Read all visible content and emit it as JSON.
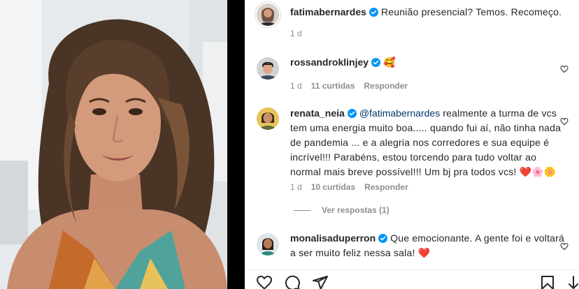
{
  "post": {
    "author": "fatimabernardes",
    "caption": "Reunião presencial? Temos. Recomeço.",
    "age": "1 d"
  },
  "comments": [
    {
      "user": "rossandroklinjey",
      "verified": true,
      "text": "🥰",
      "age": "1 d",
      "likes": "11 curtidas",
      "reply_label": "Responder"
    },
    {
      "user": "renata_neia",
      "verified": true,
      "mention": "@fatimabernardes",
      "text": " realmente a turma de vcs tem uma energia muito boa..... quando fui aí, não tinha nada de pandemia ... e a alegria nos corredores e sua equipe é incrível!!! Parabéns, estou torcendo para tudo voltar ao normal mais breve possível!!! Um bj pra todos vcs! ",
      "emoji": "❤️🌸🌼",
      "age": "1 d",
      "likes": "10 curtidas",
      "reply_label": "Responder",
      "view_replies": "Ver respostas (1)"
    },
    {
      "user": "monalisaduperron",
      "verified": true,
      "text": "Que emocionante. A gente foi e voltará a ser muito feliz nessa sala! ",
      "emoji": "❤️"
    }
  ],
  "icons": {
    "like": "heart-outline-icon",
    "comment": "comment-bubble-icon",
    "share": "paper-plane-icon",
    "save": "bookmark-icon",
    "verified": "verified-badge-icon",
    "comment_like": "small-heart-icon"
  },
  "colors": {
    "verified": "#0095f6",
    "mention": "#00376b",
    "meta": "#8e8e8e",
    "text": "#262626",
    "heart_emoji": "#ed4956"
  }
}
